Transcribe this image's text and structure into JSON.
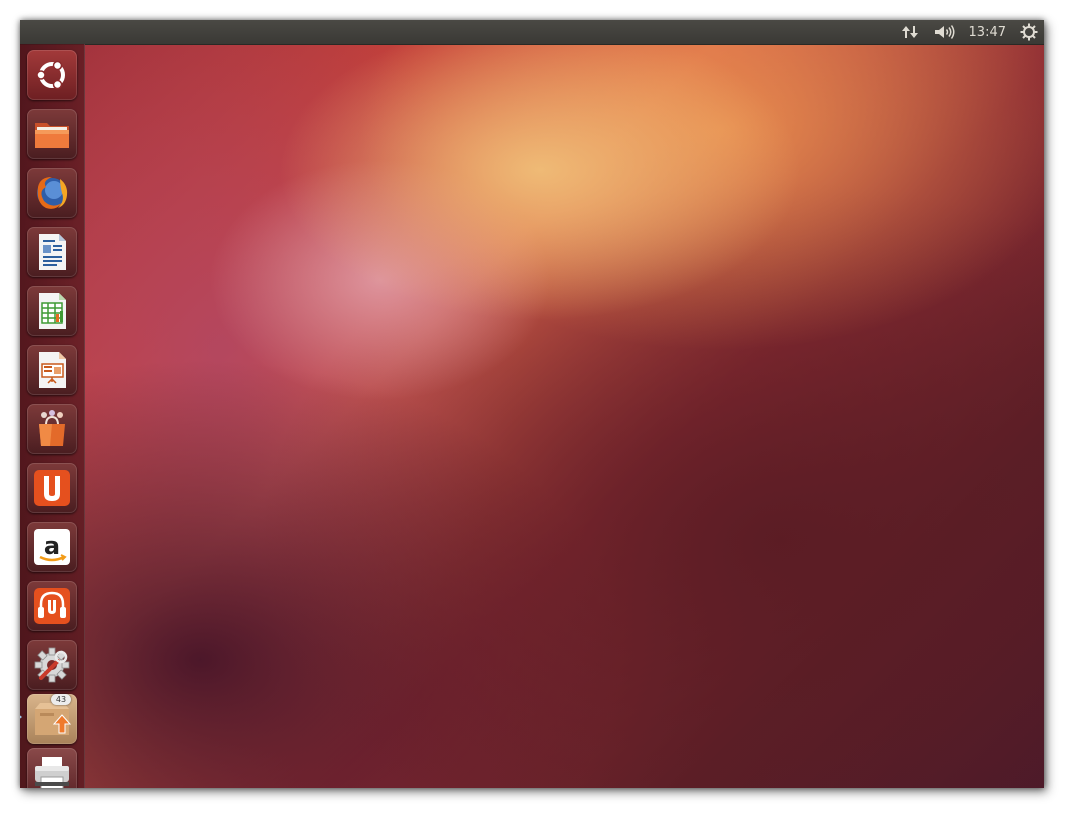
{
  "top_panel": {
    "indicators": [
      {
        "name": "network-icon"
      },
      {
        "name": "volume-icon"
      }
    ],
    "clock": "13:47",
    "session_icon": "gear-icon"
  },
  "launcher": {
    "items": [
      {
        "name": "dash-home",
        "icon": "ubuntu-logo-icon"
      },
      {
        "name": "files",
        "icon": "folder-icon"
      },
      {
        "name": "firefox",
        "icon": "firefox-icon"
      },
      {
        "name": "libreoffice-writer",
        "icon": "writer-icon"
      },
      {
        "name": "libreoffice-calc",
        "icon": "calc-icon"
      },
      {
        "name": "libreoffice-impress",
        "icon": "impress-icon"
      },
      {
        "name": "software-center",
        "icon": "shopping-bag-icon"
      },
      {
        "name": "ubuntu-one",
        "icon": "ubuntu-one-icon"
      },
      {
        "name": "amazon",
        "icon": "amazon-icon"
      },
      {
        "name": "ubuntu-one-music",
        "icon": "headphones-icon"
      },
      {
        "name": "system-settings",
        "icon": "settings-icon"
      },
      {
        "name": "update-manager",
        "icon": "package-update-icon",
        "badge": "43"
      },
      {
        "name": "printer",
        "icon": "printer-icon"
      }
    ]
  }
}
